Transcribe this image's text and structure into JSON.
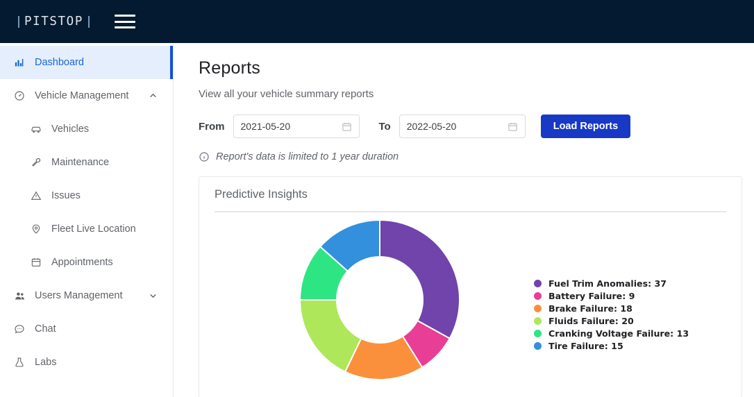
{
  "header": {
    "logo_text": "PITSTOP",
    "menu_icon": "hamburger-menu-icon"
  },
  "sidebar": {
    "items": [
      {
        "label": "Dashboard",
        "icon": "bar-chart-icon",
        "active": true,
        "sub": false,
        "chevron": ""
      },
      {
        "label": "Vehicle Management",
        "icon": "gauge-icon",
        "active": false,
        "sub": false,
        "chevron": "up"
      },
      {
        "label": "Vehicles",
        "icon": "car-icon",
        "active": false,
        "sub": true,
        "chevron": ""
      },
      {
        "label": "Maintenance",
        "icon": "wrench-icon",
        "active": false,
        "sub": true,
        "chevron": ""
      },
      {
        "label": "Issues",
        "icon": "warning-triangle-icon",
        "active": false,
        "sub": true,
        "chevron": ""
      },
      {
        "label": "Fleet Live Location",
        "icon": "map-pin-icon",
        "active": false,
        "sub": true,
        "chevron": ""
      },
      {
        "label": "Appointments",
        "icon": "calendar-icon",
        "active": false,
        "sub": true,
        "chevron": ""
      },
      {
        "label": "Users Management",
        "icon": "users-icon",
        "active": false,
        "sub": false,
        "chevron": "down"
      },
      {
        "label": "Chat",
        "icon": "chat-bubble-icon",
        "active": false,
        "sub": false,
        "chevron": ""
      },
      {
        "label": "Labs",
        "icon": "flask-icon",
        "active": false,
        "sub": false,
        "chevron": ""
      }
    ]
  },
  "main": {
    "title": "Reports",
    "subtitle": "View all your vehicle summary reports",
    "filters": {
      "from_label": "From",
      "from_value": "2021-05-20",
      "to_label": "To",
      "to_value": "2022-05-20",
      "load_button": "Load Reports"
    },
    "note": "Report's data is limited to 1 year duration",
    "card": {
      "title": "Predictive Insights"
    }
  },
  "chart_data": {
    "type": "pie",
    "variant": "donut",
    "title": "Predictive Insights",
    "start_angle_deg": 0,
    "direction": "clockwise",
    "total": 112,
    "legend_position": "right",
    "categories": [
      "Fuel Trim Anomalies",
      "Battery Failure",
      "Brake Failure",
      "Fluids Failure",
      "Cranking Voltage Failure",
      "Tire Failure"
    ],
    "values": [
      37,
      9,
      18,
      20,
      13,
      15
    ],
    "colors": [
      "#7044ab",
      "#e83e95",
      "#fb903c",
      "#aee75a",
      "#2ee583",
      "#3390dc"
    ],
    "legend_entries": [
      "Fuel Trim Anomalies: 37",
      "Battery Failure: 9",
      "Brake Failure: 18",
      "Fluids Failure: 20",
      "Cranking Voltage Failure: 13",
      "Tire Failure: 15"
    ]
  }
}
